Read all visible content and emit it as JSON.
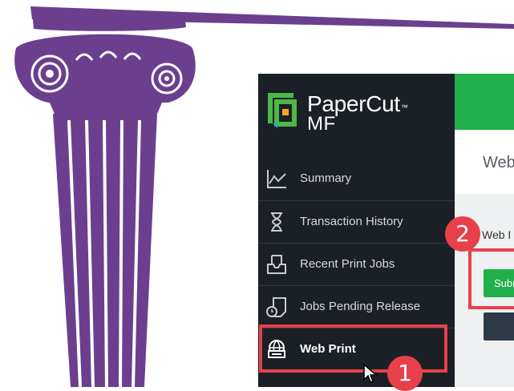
{
  "brand": {
    "name": "PaperCut",
    "trademark": "™",
    "edition": "MF",
    "colors": {
      "green": "#4cb848",
      "orange": "#f5a623",
      "blue": "#2aa5e0"
    }
  },
  "sidebar": {
    "items": [
      {
        "label": "Summary",
        "icon": "line-chart-icon",
        "active": false
      },
      {
        "label": "Transaction History",
        "icon": "hourglass-icon",
        "active": false
      },
      {
        "label": "Recent Print Jobs",
        "icon": "printer-tray-icon",
        "active": false
      },
      {
        "label": "Jobs Pending Release",
        "icon": "pending-document-icon",
        "active": false
      },
      {
        "label": "Web Print",
        "icon": "web-print-icon",
        "active": true
      }
    ]
  },
  "main": {
    "page_title": "Web",
    "section_label": "Web I",
    "submit_label": "Subm"
  },
  "annotations": {
    "step1": "1",
    "step2": "2",
    "highlight_color": "#e8404a"
  },
  "colors": {
    "sidebar_bg": "#1b2026",
    "accent_green": "#21b04b",
    "pillar_purple": "#6b3f8e"
  }
}
